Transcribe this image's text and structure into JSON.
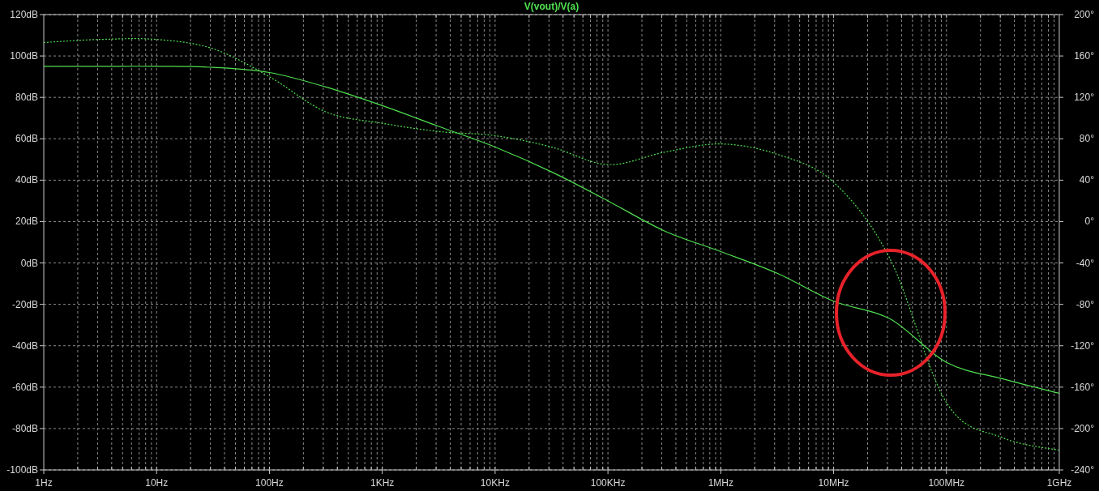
{
  "chart_data": {
    "type": "line",
    "title": "V(vout)/V(a)",
    "grid": true,
    "categories": [
      "1Hz",
      null,
      "10Hz",
      null,
      "100Hz",
      null,
      "1KHz",
      null,
      "10KHz",
      null,
      "100KHz",
      null,
      "1MHz",
      null,
      "10MHz",
      null,
      "100MHz",
      null,
      "1GHz"
    ],
    "series": [
      {
        "color": "#50e050",
        "line_style": "solid",
        "values": [
          95,
          95,
          95,
          94.5,
          92,
          85,
          76,
          66,
          56,
          44,
          30,
          15.5,
          5.5,
          -5,
          -18.5,
          -27,
          -48,
          -56,
          -63
        ]
      },
      {
        "color": "#50e050",
        "line_style": "dashed",
        "axis": "y2",
        "values": [
          173,
          176,
          176,
          167,
          140,
          106,
          95,
          87,
          83,
          72,
          55,
          67,
          75,
          65,
          38,
          -36,
          -175,
          -209,
          -221
        ]
      }
    ],
    "ylim": [
      -100,
      120
    ],
    "yticks": [
      {
        "value": 120,
        "label": "120dB"
      },
      {
        "value": 100,
        "label": "100dB"
      },
      {
        "value": 80,
        "label": "80dB"
      },
      {
        "value": 60,
        "label": "60dB"
      },
      {
        "value": 40,
        "label": "40dB"
      },
      {
        "value": 20,
        "label": "20dB"
      },
      {
        "value": 0,
        "label": "0dB"
      },
      {
        "value": -20,
        "label": "-20dB"
      },
      {
        "value": -40,
        "label": "-40dB"
      },
      {
        "value": -60,
        "label": "-60dB"
      },
      {
        "value": -80,
        "label": "-80dB"
      },
      {
        "value": -100,
        "label": "-100dB"
      }
    ],
    "y2lim": [
      -240,
      200
    ],
    "y2ticks": [
      {
        "value": 200,
        "label": "200°"
      },
      {
        "value": 160,
        "label": "160°"
      },
      {
        "value": 120,
        "label": "120°"
      },
      {
        "value": 80,
        "label": "80°"
      },
      {
        "value": 40,
        "label": "40°"
      },
      {
        "value": 0,
        "label": "0°"
      },
      {
        "value": -40,
        "label": "-40°"
      },
      {
        "value": -80,
        "label": "-80°"
      },
      {
        "value": -120,
        "label": "-120°"
      },
      {
        "value": -160,
        "label": "-160°"
      },
      {
        "value": -200,
        "label": "-200°"
      },
      {
        "value": -240,
        "label": "-240°"
      }
    ]
  },
  "highlight": {
    "kind": "ellipse",
    "color": "#e8222a"
  }
}
